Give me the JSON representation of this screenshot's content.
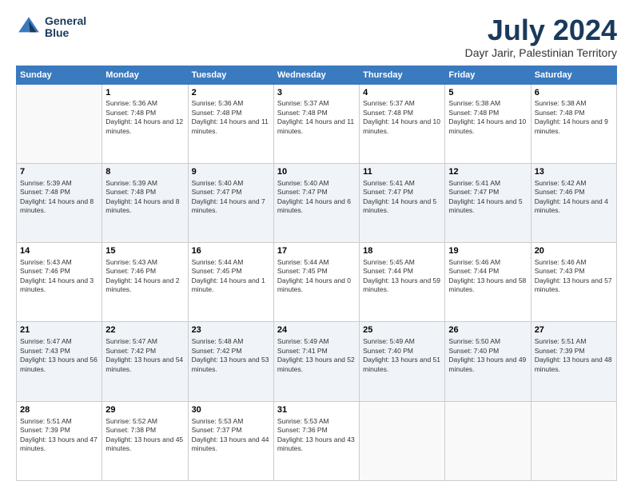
{
  "logo": {
    "line1": "General",
    "line2": "Blue"
  },
  "title": "July 2024",
  "subtitle": "Dayr Jarir, Palestinian Territory",
  "days": [
    "Sunday",
    "Monday",
    "Tuesday",
    "Wednesday",
    "Thursday",
    "Friday",
    "Saturday"
  ],
  "weeks": [
    [
      {
        "day": "",
        "sunrise": "",
        "sunset": "",
        "daylight": ""
      },
      {
        "day": "1",
        "sunrise": "Sunrise: 5:36 AM",
        "sunset": "Sunset: 7:48 PM",
        "daylight": "Daylight: 14 hours and 12 minutes."
      },
      {
        "day": "2",
        "sunrise": "Sunrise: 5:36 AM",
        "sunset": "Sunset: 7:48 PM",
        "daylight": "Daylight: 14 hours and 11 minutes."
      },
      {
        "day": "3",
        "sunrise": "Sunrise: 5:37 AM",
        "sunset": "Sunset: 7:48 PM",
        "daylight": "Daylight: 14 hours and 11 minutes."
      },
      {
        "day": "4",
        "sunrise": "Sunrise: 5:37 AM",
        "sunset": "Sunset: 7:48 PM",
        "daylight": "Daylight: 14 hours and 10 minutes."
      },
      {
        "day": "5",
        "sunrise": "Sunrise: 5:38 AM",
        "sunset": "Sunset: 7:48 PM",
        "daylight": "Daylight: 14 hours and 10 minutes."
      },
      {
        "day": "6",
        "sunrise": "Sunrise: 5:38 AM",
        "sunset": "Sunset: 7:48 PM",
        "daylight": "Daylight: 14 hours and 9 minutes."
      }
    ],
    [
      {
        "day": "7",
        "sunrise": "Sunrise: 5:39 AM",
        "sunset": "Sunset: 7:48 PM",
        "daylight": "Daylight: 14 hours and 8 minutes."
      },
      {
        "day": "8",
        "sunrise": "Sunrise: 5:39 AM",
        "sunset": "Sunset: 7:48 PM",
        "daylight": "Daylight: 14 hours and 8 minutes."
      },
      {
        "day": "9",
        "sunrise": "Sunrise: 5:40 AM",
        "sunset": "Sunset: 7:47 PM",
        "daylight": "Daylight: 14 hours and 7 minutes."
      },
      {
        "day": "10",
        "sunrise": "Sunrise: 5:40 AM",
        "sunset": "Sunset: 7:47 PM",
        "daylight": "Daylight: 14 hours and 6 minutes."
      },
      {
        "day": "11",
        "sunrise": "Sunrise: 5:41 AM",
        "sunset": "Sunset: 7:47 PM",
        "daylight": "Daylight: 14 hours and 5 minutes."
      },
      {
        "day": "12",
        "sunrise": "Sunrise: 5:41 AM",
        "sunset": "Sunset: 7:47 PM",
        "daylight": "Daylight: 14 hours and 5 minutes."
      },
      {
        "day": "13",
        "sunrise": "Sunrise: 5:42 AM",
        "sunset": "Sunset: 7:46 PM",
        "daylight": "Daylight: 14 hours and 4 minutes."
      }
    ],
    [
      {
        "day": "14",
        "sunrise": "Sunrise: 5:43 AM",
        "sunset": "Sunset: 7:46 PM",
        "daylight": "Daylight: 14 hours and 3 minutes."
      },
      {
        "day": "15",
        "sunrise": "Sunrise: 5:43 AM",
        "sunset": "Sunset: 7:46 PM",
        "daylight": "Daylight: 14 hours and 2 minutes."
      },
      {
        "day": "16",
        "sunrise": "Sunrise: 5:44 AM",
        "sunset": "Sunset: 7:45 PM",
        "daylight": "Daylight: 14 hours and 1 minute."
      },
      {
        "day": "17",
        "sunrise": "Sunrise: 5:44 AM",
        "sunset": "Sunset: 7:45 PM",
        "daylight": "Daylight: 14 hours and 0 minutes."
      },
      {
        "day": "18",
        "sunrise": "Sunrise: 5:45 AM",
        "sunset": "Sunset: 7:44 PM",
        "daylight": "Daylight: 13 hours and 59 minutes."
      },
      {
        "day": "19",
        "sunrise": "Sunrise: 5:46 AM",
        "sunset": "Sunset: 7:44 PM",
        "daylight": "Daylight: 13 hours and 58 minutes."
      },
      {
        "day": "20",
        "sunrise": "Sunrise: 5:46 AM",
        "sunset": "Sunset: 7:43 PM",
        "daylight": "Daylight: 13 hours and 57 minutes."
      }
    ],
    [
      {
        "day": "21",
        "sunrise": "Sunrise: 5:47 AM",
        "sunset": "Sunset: 7:43 PM",
        "daylight": "Daylight: 13 hours and 56 minutes."
      },
      {
        "day": "22",
        "sunrise": "Sunrise: 5:47 AM",
        "sunset": "Sunset: 7:42 PM",
        "daylight": "Daylight: 13 hours and 54 minutes."
      },
      {
        "day": "23",
        "sunrise": "Sunrise: 5:48 AM",
        "sunset": "Sunset: 7:42 PM",
        "daylight": "Daylight: 13 hours and 53 minutes."
      },
      {
        "day": "24",
        "sunrise": "Sunrise: 5:49 AM",
        "sunset": "Sunset: 7:41 PM",
        "daylight": "Daylight: 13 hours and 52 minutes."
      },
      {
        "day": "25",
        "sunrise": "Sunrise: 5:49 AM",
        "sunset": "Sunset: 7:40 PM",
        "daylight": "Daylight: 13 hours and 51 minutes."
      },
      {
        "day": "26",
        "sunrise": "Sunrise: 5:50 AM",
        "sunset": "Sunset: 7:40 PM",
        "daylight": "Daylight: 13 hours and 49 minutes."
      },
      {
        "day": "27",
        "sunrise": "Sunrise: 5:51 AM",
        "sunset": "Sunset: 7:39 PM",
        "daylight": "Daylight: 13 hours and 48 minutes."
      }
    ],
    [
      {
        "day": "28",
        "sunrise": "Sunrise: 5:51 AM",
        "sunset": "Sunset: 7:39 PM",
        "daylight": "Daylight: 13 hours and 47 minutes."
      },
      {
        "day": "29",
        "sunrise": "Sunrise: 5:52 AM",
        "sunset": "Sunset: 7:38 PM",
        "daylight": "Daylight: 13 hours and 45 minutes."
      },
      {
        "day": "30",
        "sunrise": "Sunrise: 5:53 AM",
        "sunset": "Sunset: 7:37 PM",
        "daylight": "Daylight: 13 hours and 44 minutes."
      },
      {
        "day": "31",
        "sunrise": "Sunrise: 5:53 AM",
        "sunset": "Sunset: 7:36 PM",
        "daylight": "Daylight: 13 hours and 43 minutes."
      },
      {
        "day": "",
        "sunrise": "",
        "sunset": "",
        "daylight": ""
      },
      {
        "day": "",
        "sunrise": "",
        "sunset": "",
        "daylight": ""
      },
      {
        "day": "",
        "sunrise": "",
        "sunset": "",
        "daylight": ""
      }
    ]
  ]
}
